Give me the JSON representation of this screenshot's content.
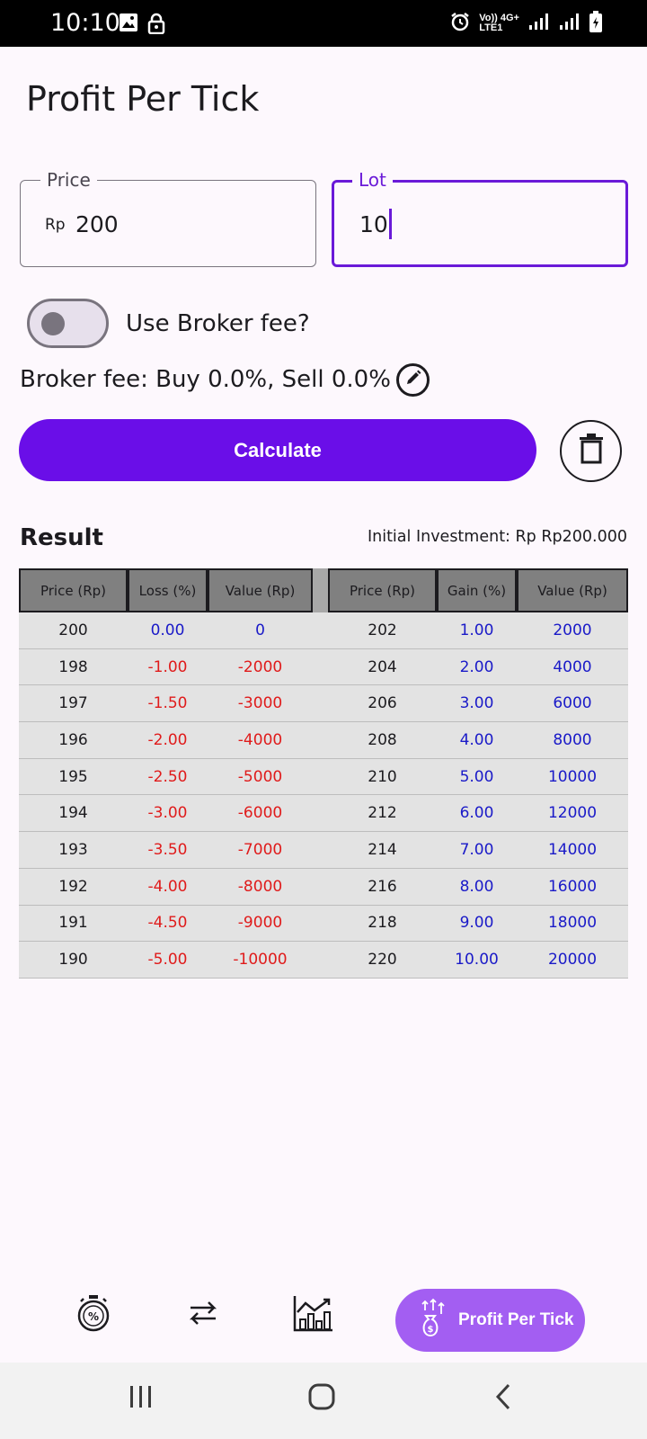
{
  "status_bar": {
    "time": "10:10",
    "network_label_top": "Vo)) 4G+",
    "network_label_bottom": "LTE1"
  },
  "page_title": "Profit Per Tick",
  "inputs": {
    "price": {
      "label": "Price",
      "prefix": "Rp",
      "value": "200"
    },
    "lot": {
      "label": "Lot",
      "value": "10"
    }
  },
  "broker_switch": {
    "label": "Use Broker fee?",
    "on": false
  },
  "broker_fee_text": "Broker fee: Buy 0.0%, Sell 0.0%",
  "calculate_label": "Calculate",
  "result": {
    "title": "Result",
    "initial_investment": "Initial Investment: Rp Rp200.000"
  },
  "table": {
    "loss_headers": [
      "Price (Rp)",
      "Loss (%)",
      "Value (Rp)"
    ],
    "gain_headers": [
      "Price (Rp)",
      "Gain (%)",
      "Value (Rp)"
    ],
    "rows": [
      {
        "lp": "200",
        "lpct": "0.00",
        "lval": "0",
        "gp": "202",
        "gpct": "1.00",
        "gval": "2000",
        "neutral": true
      },
      {
        "lp": "198",
        "lpct": "-1.00",
        "lval": "-2000",
        "gp": "204",
        "gpct": "2.00",
        "gval": "4000"
      },
      {
        "lp": "197",
        "lpct": "-1.50",
        "lval": "-3000",
        "gp": "206",
        "gpct": "3.00",
        "gval": "6000"
      },
      {
        "lp": "196",
        "lpct": "-2.00",
        "lval": "-4000",
        "gp": "208",
        "gpct": "4.00",
        "gval": "8000"
      },
      {
        "lp": "195",
        "lpct": "-2.50",
        "lval": "-5000",
        "gp": "210",
        "gpct": "5.00",
        "gval": "10000"
      },
      {
        "lp": "194",
        "lpct": "-3.00",
        "lval": "-6000",
        "gp": "212",
        "gpct": "6.00",
        "gval": "12000"
      },
      {
        "lp": "193",
        "lpct": "-3.50",
        "lval": "-7000",
        "gp": "214",
        "gpct": "7.00",
        "gval": "14000"
      },
      {
        "lp": "192",
        "lpct": "-4.00",
        "lval": "-8000",
        "gp": "216",
        "gpct": "8.00",
        "gval": "16000"
      },
      {
        "lp": "191",
        "lpct": "-4.50",
        "lval": "-9000",
        "gp": "218",
        "gpct": "9.00",
        "gval": "18000"
      },
      {
        "lp": "190",
        "lpct": "-5.00",
        "lval": "-10000",
        "gp": "220",
        "gpct": "10.00",
        "gval": "20000"
      }
    ]
  },
  "bottom_nav": {
    "items": [
      "stopwatch-percent-icon",
      "swap-arrows-icon",
      "chart-growth-icon"
    ],
    "active_label": "Profit Per Tick",
    "active_icon": "money-bag-arrows-icon"
  },
  "colors": {
    "primary": "#6a0ee8",
    "nav_active": "#a35ef2",
    "loss": "#e01b1b",
    "gain": "#1a1ac8"
  }
}
